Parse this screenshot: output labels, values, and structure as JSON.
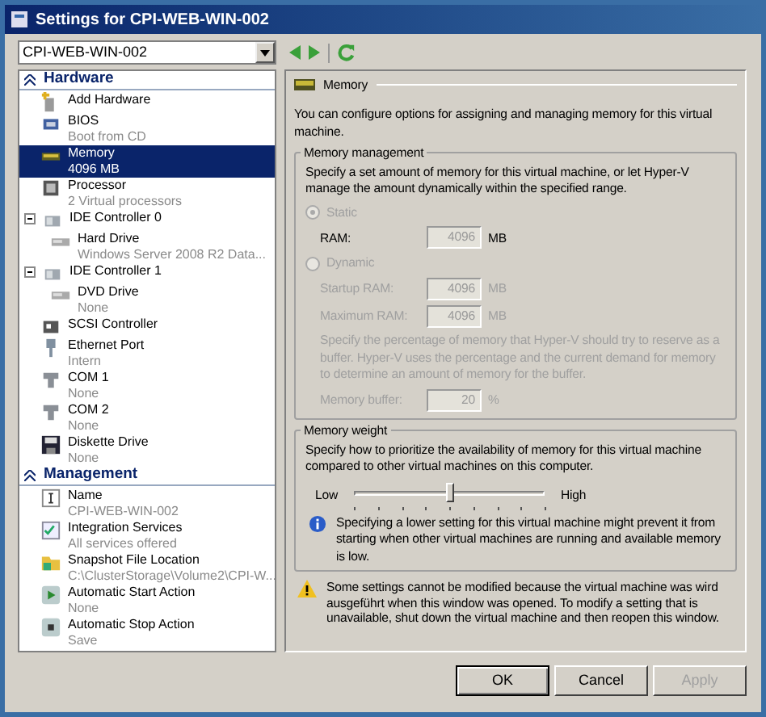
{
  "window": {
    "title": "Settings for CPI-WEB-WIN-002"
  },
  "vm_select": {
    "value": "CPI-WEB-WIN-002"
  },
  "sections": [
    {
      "title": "Hardware",
      "expanded": true,
      "items": [
        {
          "label": "Add Hardware",
          "selected": false
        },
        {
          "label": "BIOS",
          "sub": "Boot from CD",
          "selected": false
        },
        {
          "label": "Memory",
          "sub": "4096 MB",
          "selected": true
        },
        {
          "label": "Processor",
          "sub": "2 Virtual processors",
          "selected": false
        },
        {
          "label": "IDE Controller 0",
          "selected": false,
          "expanded": true,
          "children": [
            {
              "label": "Hard Drive",
              "sub": "Windows Server 2008 R2 Data...",
              "selected": false
            }
          ]
        },
        {
          "label": "IDE Controller 1",
          "selected": false,
          "expanded": true,
          "children": [
            {
              "label": "DVD Drive",
              "sub": "None",
              "selected": false
            }
          ]
        },
        {
          "label": "SCSI Controller",
          "selected": false
        },
        {
          "label": "Ethernet Port",
          "sub": "Intern",
          "selected": false
        },
        {
          "label": "COM 1",
          "sub": "None",
          "selected": false
        },
        {
          "label": "COM 2",
          "sub": "None",
          "selected": false
        },
        {
          "label": "Diskette Drive",
          "sub": "None",
          "selected": false
        }
      ]
    },
    {
      "title": "Management",
      "expanded": true,
      "items": [
        {
          "label": "Name",
          "sub": "CPI-WEB-WIN-002",
          "selected": false
        },
        {
          "label": "Integration Services",
          "sub": "All services offered",
          "selected": false
        },
        {
          "label": "Snapshot File Location",
          "sub": "C:\\ClusterStorage\\Volume2\\CPI-W...",
          "selected": false
        },
        {
          "label": "Automatic Start Action",
          "sub": "None",
          "selected": false
        },
        {
          "label": "Automatic Stop Action",
          "sub": "Save",
          "selected": false
        }
      ]
    }
  ],
  "panel": {
    "title": "Memory",
    "intro": "You can configure options for assigning and managing memory for this virtual machine.",
    "management": {
      "legend": "Memory management",
      "description": "Specify a set amount of memory for this virtual machine, or let Hyper-V manage the amount dynamically within the specified range.",
      "static": {
        "label": "Static",
        "selected": true,
        "disabled": true,
        "ram_label": "RAM:",
        "ram": "4096",
        "unit": "MB"
      },
      "dynamic": {
        "label": "Dynamic",
        "selected": false,
        "disabled": true,
        "fields": [
          {
            "label": "Startup RAM:",
            "value": "4096",
            "unit": "MB"
          },
          {
            "label": "Maximum RAM:",
            "value": "4096",
            "unit": "MB"
          }
        ],
        "buffer_note": "Specify the percentage of memory that Hyper-V should try to reserve as a buffer. Hyper-V uses the percentage and the current demand for memory to determine an amount of memory for the buffer.",
        "buffer": {
          "label": "Memory buffer:",
          "value": "20",
          "unit": "%"
        }
      }
    },
    "weight": {
      "legend": "Memory weight",
      "description": "Specify how to prioritize the availability of memory for this virtual machine compared to other virtual machines on this computer.",
      "low": "Low",
      "high": "High",
      "level": 0.5,
      "info": "Specifying a lower setting for this virtual machine might prevent it from starting when other virtual machines are running and available memory is low."
    },
    "warning": "Some settings cannot be modified because the virtual machine was wird ausgeführt when this window was opened. To modify a setting that is unavailable, shut down the virtual machine and then reopen this window."
  },
  "buttons": [
    {
      "label": "OK",
      "disabled": false
    },
    {
      "label": "Cancel",
      "disabled": false
    },
    {
      "label": "Apply",
      "disabled": true
    }
  ]
}
